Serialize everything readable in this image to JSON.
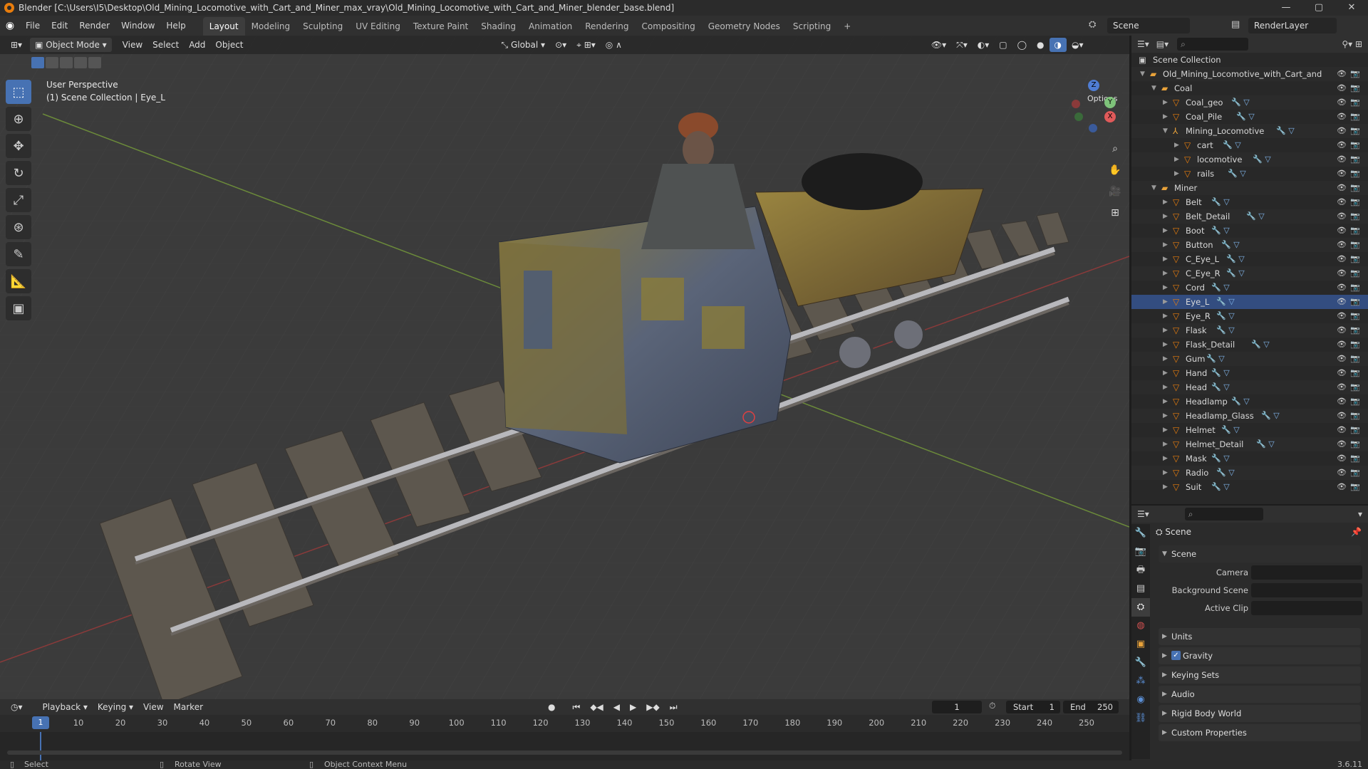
{
  "window": {
    "title": "Blender [C:\\Users\\I5\\Desktop\\Old_Mining_Locomotive_with_Cart_and_Miner_max_vray\\Old_Mining_Locomotive_with_Cart_and_Miner_blender_base.blend]",
    "min": "—",
    "max": "▢",
    "close": "✕"
  },
  "menubar": {
    "items": [
      "File",
      "Edit",
      "Render",
      "Window",
      "Help"
    ]
  },
  "workspaces": {
    "tabs": [
      "Layout",
      "Modeling",
      "Sculpting",
      "UV Editing",
      "Texture Paint",
      "Shading",
      "Animation",
      "Rendering",
      "Compositing",
      "Geometry Nodes",
      "Scripting"
    ],
    "add": "+",
    "active": "Layout"
  },
  "scene_selector": {
    "value": "Scene"
  },
  "viewlayer_selector": {
    "value": "RenderLayer"
  },
  "viewport": {
    "mode": "Object Mode",
    "menus": [
      "View",
      "Select",
      "Add",
      "Object"
    ],
    "transform_orientation": "Global",
    "options": "Options",
    "info_line1": "User Perspective",
    "info_line2": "(1) Scene Collection | Eye_L",
    "gizmo": {
      "z": "Z",
      "y": "Y",
      "x": "X"
    }
  },
  "outliner": {
    "root": "Scene Collection",
    "rows": [
      {
        "label": "Old_Mining_Locomotive_with_Cart_and",
        "indent": 1,
        "type": "collection",
        "open": true
      },
      {
        "label": "Coal",
        "indent": 2,
        "type": "collection",
        "open": true
      },
      {
        "label": "Coal_geo",
        "indent": 3,
        "type": "mesh"
      },
      {
        "label": "Coal_Pile",
        "indent": 3,
        "type": "mesh"
      },
      {
        "label": "Mining_Locomotive",
        "indent": 3,
        "type": "empty",
        "open": true
      },
      {
        "label": "cart",
        "indent": 4,
        "type": "mesh"
      },
      {
        "label": "locomotive",
        "indent": 4,
        "type": "mesh"
      },
      {
        "label": "rails",
        "indent": 4,
        "type": "mesh"
      },
      {
        "label": "Miner",
        "indent": 2,
        "type": "collection",
        "open": true
      },
      {
        "label": "Belt",
        "indent": 3,
        "type": "mesh"
      },
      {
        "label": "Belt_Detail",
        "indent": 3,
        "type": "mesh"
      },
      {
        "label": "Boot",
        "indent": 3,
        "type": "mesh"
      },
      {
        "label": "Button",
        "indent": 3,
        "type": "mesh"
      },
      {
        "label": "C_Eye_L",
        "indent": 3,
        "type": "mesh"
      },
      {
        "label": "C_Eye_R",
        "indent": 3,
        "type": "mesh"
      },
      {
        "label": "Cord",
        "indent": 3,
        "type": "mesh"
      },
      {
        "label": "Eye_L",
        "indent": 3,
        "type": "mesh",
        "selected": true
      },
      {
        "label": "Eye_R",
        "indent": 3,
        "type": "mesh"
      },
      {
        "label": "Flask",
        "indent": 3,
        "type": "mesh"
      },
      {
        "label": "Flask_Detail",
        "indent": 3,
        "type": "mesh"
      },
      {
        "label": "Gum",
        "indent": 3,
        "type": "mesh"
      },
      {
        "label": "Hand",
        "indent": 3,
        "type": "mesh"
      },
      {
        "label": "Head",
        "indent": 3,
        "type": "mesh"
      },
      {
        "label": "Headlamp",
        "indent": 3,
        "type": "mesh"
      },
      {
        "label": "Headlamp_Glass",
        "indent": 3,
        "type": "mesh"
      },
      {
        "label": "Helmet",
        "indent": 3,
        "type": "mesh"
      },
      {
        "label": "Helmet_Detail",
        "indent": 3,
        "type": "mesh"
      },
      {
        "label": "Mask",
        "indent": 3,
        "type": "mesh"
      },
      {
        "label": "Radio",
        "indent": 3,
        "type": "mesh"
      },
      {
        "label": "Suit",
        "indent": 3,
        "type": "mesh"
      }
    ]
  },
  "properties": {
    "context": "Scene",
    "panel": "Scene",
    "camera_label": "Camera",
    "bg_scene_label": "Background Scene",
    "active_clip_label": "Active Clip",
    "sections": [
      "Units",
      "Gravity",
      "Keying Sets",
      "Audio",
      "Rigid Body World",
      "Custom Properties"
    ],
    "gravity_checked": true
  },
  "timeline": {
    "menus": [
      "Playback",
      "Keying",
      "View",
      "Marker"
    ],
    "current_frame": "1",
    "start_label": "Start",
    "start": "1",
    "end_label": "End",
    "end": "250",
    "ticks": [
      "1",
      "10",
      "20",
      "30",
      "40",
      "50",
      "60",
      "70",
      "80",
      "90",
      "100",
      "110",
      "120",
      "130",
      "140",
      "150",
      "160",
      "170",
      "180",
      "190",
      "200",
      "210",
      "220",
      "230",
      "240",
      "250"
    ]
  },
  "statusbar": {
    "select": "Select",
    "rotate": "Rotate View",
    "context": "Object Context Menu",
    "version": "3.6.11"
  },
  "colors": {
    "accent": "#4772b3",
    "collection_icon": "#e8a23a",
    "mesh_icon": "#e87d0d",
    "selected_row": "#334d80"
  }
}
